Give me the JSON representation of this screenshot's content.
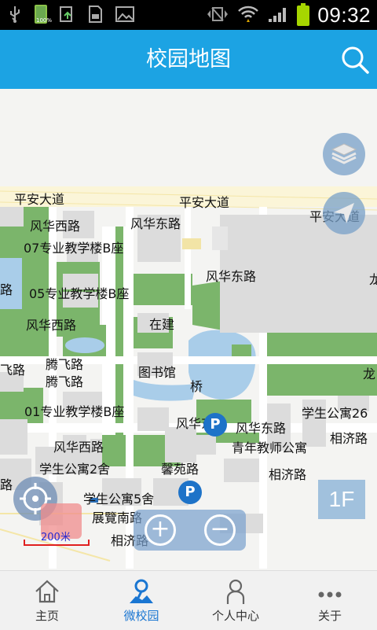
{
  "status_bar": {
    "time": "09:32",
    "battery_small_label": "100%"
  },
  "header": {
    "title": "校园地图"
  },
  "map": {
    "labels": {
      "road_pingan_1": "平安大道",
      "road_pingan_2": "平安大道",
      "road_pingan_3": "平安大道",
      "road_fenghua_west_1": "风华西路",
      "road_fenghua_west_2": "风华西路",
      "road_fenghua_west_3": "风华西路",
      "road_fenghua_east_1": "风华东路",
      "road_fenghua_east_2": "风华东路",
      "road_fenghua_east_3": "风华东路",
      "road_fenghua_mid": "风华东路",
      "bldg_07": "07专业教学楼B座",
      "bldg_05": "05专业教学楼B座",
      "bldg_01": "01专业教学楼B座",
      "road_lu_left": "路",
      "road_lu_left_2": "路",
      "road_long_right": "龙",
      "road_long_right2": "龙",
      "road_tengfei_1": "腾飞路",
      "road_tengfei_2": "腾飞路",
      "road_fei_left": "飞路",
      "under_construction": "在建",
      "library": "图书馆",
      "bridge": "桥",
      "dorm_26": "学生公寓26",
      "road_xiangji_1": "相济路",
      "road_xiangji_2": "相济路",
      "road_xiangji_3": "相济路",
      "teacher_apt": "青年教师公寓",
      "dorm_2": "学生公寓2舍",
      "road_xinyuan": "馨苑路",
      "dorm_5": "学生公寓5舍",
      "road_zhanlan_south": "展覽南路"
    },
    "parking_label": "P",
    "floor_label": "1F",
    "scale_label": "200米",
    "zoom_in_label": "+",
    "zoom_out_label": "−"
  },
  "bottom_nav": {
    "items": [
      {
        "label": "主页",
        "icon": "home-icon"
      },
      {
        "label": "微校园",
        "icon": "map-pin-icon"
      },
      {
        "label": "个人中心",
        "icon": "person-icon"
      },
      {
        "label": "关于",
        "icon": "more-icon"
      }
    ]
  },
  "colors": {
    "header": "#1ca3e3",
    "map_bg": "#f4f4f2",
    "green": "#7bb56b",
    "water": "#a9cde9",
    "nav_active": "#1a76d2"
  }
}
